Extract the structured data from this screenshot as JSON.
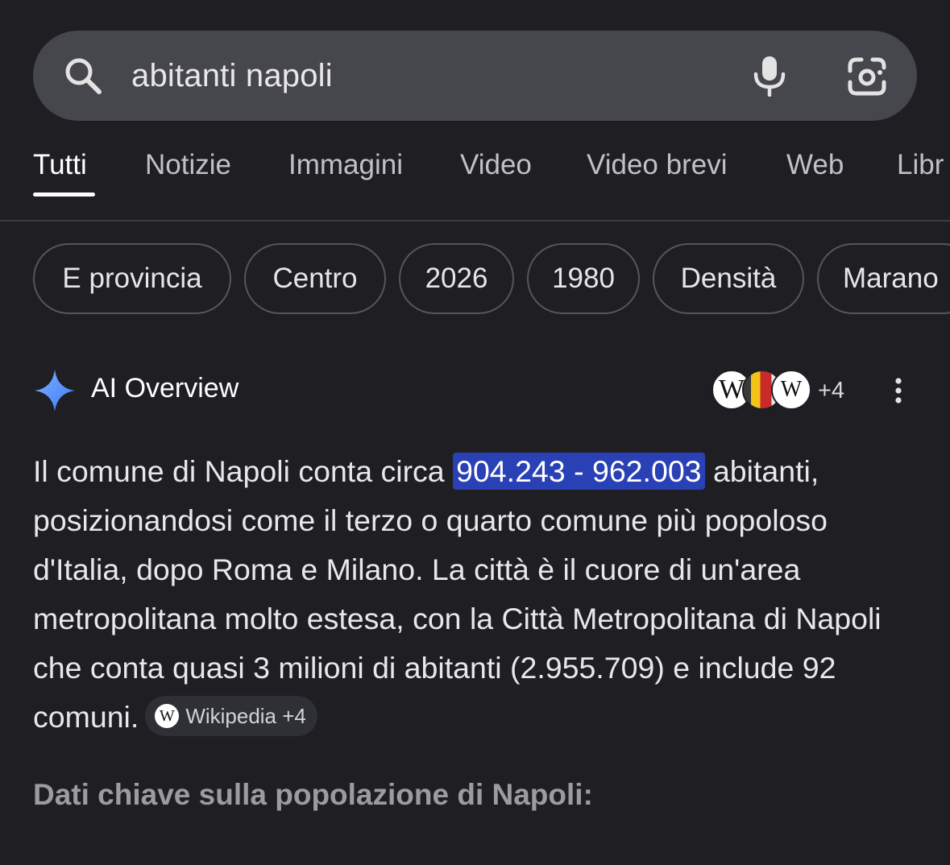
{
  "search": {
    "query": "abitanti napoli"
  },
  "tabs": [
    {
      "label": "Tutti",
      "active": true
    },
    {
      "label": "Notizie",
      "active": false
    },
    {
      "label": "Immagini",
      "active": false
    },
    {
      "label": "Video",
      "active": false
    },
    {
      "label": "Video brevi",
      "active": false
    },
    {
      "label": "Web",
      "active": false
    },
    {
      "label": "Libr",
      "active": false
    }
  ],
  "chips": [
    {
      "label": "E provincia"
    },
    {
      "label": "Centro"
    },
    {
      "label": "2026"
    },
    {
      "label": "1980"
    },
    {
      "label": "Densità"
    },
    {
      "label": "Marano"
    }
  ],
  "ai_overview": {
    "title": "AI Overview",
    "avatar_1": "W",
    "avatar_3": "W",
    "sources_more": "+4",
    "text_before": "Il comune di Napoli conta circa ",
    "highlight": "904.243 - 962.003",
    "text_after": " abitanti, posizionandosi come il terzo o quarto comune più popoloso d'Italia, dopo Roma e Milano. La città è il cuore di un'area metropolitana molto estesa, con la Città Metropolitana di Napoli che conta quasi 3 milioni di abitanti (2.955.709) e include 92 comuni.",
    "source_chip_icon": "W",
    "source_chip": "Wikipedia +4",
    "section_heading": "Dati chiave sulla popolazione di Napoli:"
  },
  "colors": {
    "background": "#1f1f23",
    "search_bar": "#46474c",
    "highlight": "#2a41b5",
    "muted_heading": "#9a9ca0"
  },
  "icons": [
    "search-icon",
    "microphone-icon",
    "google-lens-icon",
    "ai-sparkle-icon",
    "more-vert-icon",
    "wikipedia-icon"
  ]
}
